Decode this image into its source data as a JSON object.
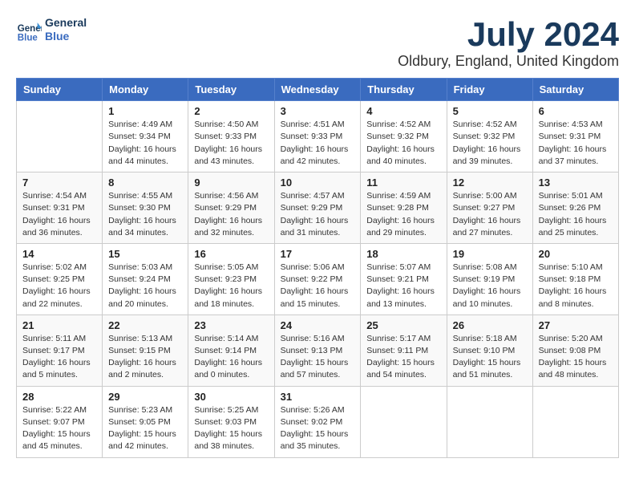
{
  "header": {
    "logo_line1": "General",
    "logo_line2": "Blue",
    "month_title": "July 2024",
    "location": "Oldbury, England, United Kingdom"
  },
  "weekdays": [
    "Sunday",
    "Monday",
    "Tuesday",
    "Wednesday",
    "Thursday",
    "Friday",
    "Saturday"
  ],
  "weeks": [
    [
      {
        "num": "",
        "empty": true
      },
      {
        "num": "1",
        "sunrise": "Sunrise: 4:49 AM",
        "sunset": "Sunset: 9:34 PM",
        "daylight": "Daylight: 16 hours and 44 minutes."
      },
      {
        "num": "2",
        "sunrise": "Sunrise: 4:50 AM",
        "sunset": "Sunset: 9:33 PM",
        "daylight": "Daylight: 16 hours and 43 minutes."
      },
      {
        "num": "3",
        "sunrise": "Sunrise: 4:51 AM",
        "sunset": "Sunset: 9:33 PM",
        "daylight": "Daylight: 16 hours and 42 minutes."
      },
      {
        "num": "4",
        "sunrise": "Sunrise: 4:52 AM",
        "sunset": "Sunset: 9:32 PM",
        "daylight": "Daylight: 16 hours and 40 minutes."
      },
      {
        "num": "5",
        "sunrise": "Sunrise: 4:52 AM",
        "sunset": "Sunset: 9:32 PM",
        "daylight": "Daylight: 16 hours and 39 minutes."
      },
      {
        "num": "6",
        "sunrise": "Sunrise: 4:53 AM",
        "sunset": "Sunset: 9:31 PM",
        "daylight": "Daylight: 16 hours and 37 minutes."
      }
    ],
    [
      {
        "num": "7",
        "sunrise": "Sunrise: 4:54 AM",
        "sunset": "Sunset: 9:31 PM",
        "daylight": "Daylight: 16 hours and 36 minutes."
      },
      {
        "num": "8",
        "sunrise": "Sunrise: 4:55 AM",
        "sunset": "Sunset: 9:30 PM",
        "daylight": "Daylight: 16 hours and 34 minutes."
      },
      {
        "num": "9",
        "sunrise": "Sunrise: 4:56 AM",
        "sunset": "Sunset: 9:29 PM",
        "daylight": "Daylight: 16 hours and 32 minutes."
      },
      {
        "num": "10",
        "sunrise": "Sunrise: 4:57 AM",
        "sunset": "Sunset: 9:29 PM",
        "daylight": "Daylight: 16 hours and 31 minutes."
      },
      {
        "num": "11",
        "sunrise": "Sunrise: 4:59 AM",
        "sunset": "Sunset: 9:28 PM",
        "daylight": "Daylight: 16 hours and 29 minutes."
      },
      {
        "num": "12",
        "sunrise": "Sunrise: 5:00 AM",
        "sunset": "Sunset: 9:27 PM",
        "daylight": "Daylight: 16 hours and 27 minutes."
      },
      {
        "num": "13",
        "sunrise": "Sunrise: 5:01 AM",
        "sunset": "Sunset: 9:26 PM",
        "daylight": "Daylight: 16 hours and 25 minutes."
      }
    ],
    [
      {
        "num": "14",
        "sunrise": "Sunrise: 5:02 AM",
        "sunset": "Sunset: 9:25 PM",
        "daylight": "Daylight: 16 hours and 22 minutes."
      },
      {
        "num": "15",
        "sunrise": "Sunrise: 5:03 AM",
        "sunset": "Sunset: 9:24 PM",
        "daylight": "Daylight: 16 hours and 20 minutes."
      },
      {
        "num": "16",
        "sunrise": "Sunrise: 5:05 AM",
        "sunset": "Sunset: 9:23 PM",
        "daylight": "Daylight: 16 hours and 18 minutes."
      },
      {
        "num": "17",
        "sunrise": "Sunrise: 5:06 AM",
        "sunset": "Sunset: 9:22 PM",
        "daylight": "Daylight: 16 hours and 15 minutes."
      },
      {
        "num": "18",
        "sunrise": "Sunrise: 5:07 AM",
        "sunset": "Sunset: 9:21 PM",
        "daylight": "Daylight: 16 hours and 13 minutes."
      },
      {
        "num": "19",
        "sunrise": "Sunrise: 5:08 AM",
        "sunset": "Sunset: 9:19 PM",
        "daylight": "Daylight: 16 hours and 10 minutes."
      },
      {
        "num": "20",
        "sunrise": "Sunrise: 5:10 AM",
        "sunset": "Sunset: 9:18 PM",
        "daylight": "Daylight: 16 hours and 8 minutes."
      }
    ],
    [
      {
        "num": "21",
        "sunrise": "Sunrise: 5:11 AM",
        "sunset": "Sunset: 9:17 PM",
        "daylight": "Daylight: 16 hours and 5 minutes."
      },
      {
        "num": "22",
        "sunrise": "Sunrise: 5:13 AM",
        "sunset": "Sunset: 9:15 PM",
        "daylight": "Daylight: 16 hours and 2 minutes."
      },
      {
        "num": "23",
        "sunrise": "Sunrise: 5:14 AM",
        "sunset": "Sunset: 9:14 PM",
        "daylight": "Daylight: 16 hours and 0 minutes."
      },
      {
        "num": "24",
        "sunrise": "Sunrise: 5:16 AM",
        "sunset": "Sunset: 9:13 PM",
        "daylight": "Daylight: 15 hours and 57 minutes."
      },
      {
        "num": "25",
        "sunrise": "Sunrise: 5:17 AM",
        "sunset": "Sunset: 9:11 PM",
        "daylight": "Daylight: 15 hours and 54 minutes."
      },
      {
        "num": "26",
        "sunrise": "Sunrise: 5:18 AM",
        "sunset": "Sunset: 9:10 PM",
        "daylight": "Daylight: 15 hours and 51 minutes."
      },
      {
        "num": "27",
        "sunrise": "Sunrise: 5:20 AM",
        "sunset": "Sunset: 9:08 PM",
        "daylight": "Daylight: 15 hours and 48 minutes."
      }
    ],
    [
      {
        "num": "28",
        "sunrise": "Sunrise: 5:22 AM",
        "sunset": "Sunset: 9:07 PM",
        "daylight": "Daylight: 15 hours and 45 minutes."
      },
      {
        "num": "29",
        "sunrise": "Sunrise: 5:23 AM",
        "sunset": "Sunset: 9:05 PM",
        "daylight": "Daylight: 15 hours and 42 minutes."
      },
      {
        "num": "30",
        "sunrise": "Sunrise: 5:25 AM",
        "sunset": "Sunset: 9:03 PM",
        "daylight": "Daylight: 15 hours and 38 minutes."
      },
      {
        "num": "31",
        "sunrise": "Sunrise: 5:26 AM",
        "sunset": "Sunset: 9:02 PM",
        "daylight": "Daylight: 15 hours and 35 minutes."
      },
      {
        "num": "",
        "empty": true
      },
      {
        "num": "",
        "empty": true
      },
      {
        "num": "",
        "empty": true
      }
    ]
  ]
}
